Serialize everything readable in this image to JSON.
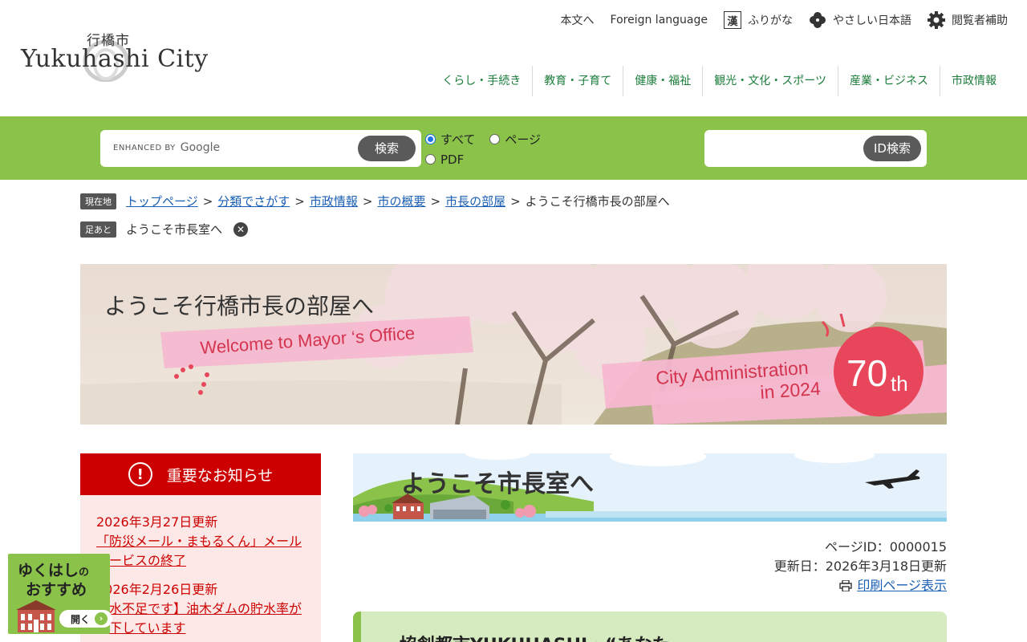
{
  "header": {
    "logo_jp": "行橋市",
    "logo_en": "Yukuhashi City",
    "util": [
      {
        "label": "本文へ",
        "icon": ""
      },
      {
        "label": "Foreign language",
        "icon": ""
      },
      {
        "label": "ふりがな",
        "icon": "kanji-icon",
        "glyph": "漢"
      },
      {
        "label": "やさしい日本語",
        "icon": "clover-icon"
      },
      {
        "label": "閲覧者補助",
        "icon": "gear-icon"
      }
    ],
    "gnav": [
      "くらし・手続き",
      "教育・子育て",
      "健康・福祉",
      "観光・文化・スポーツ",
      "産業・ビジネス",
      "市政情報"
    ]
  },
  "search": {
    "enhanced": "ENHANCED BY",
    "google": "Google",
    "button": "検索",
    "scope": [
      {
        "label": "すべて",
        "checked": true
      },
      {
        "label": "ページ",
        "checked": false
      },
      {
        "label": "PDF",
        "checked": false
      }
    ],
    "id_button": "ID検索"
  },
  "breadcrumb": {
    "tag": "現在地",
    "links": [
      "トップページ",
      "分類でさがす",
      "市政情報",
      "市の概要",
      "市長の部屋"
    ],
    "current": "ようこそ行橋市長の部屋へ"
  },
  "footprint": {
    "tag": "足あと",
    "item": "ようこそ市長室へ"
  },
  "hero": {
    "title": "ようこそ行橋市長の部屋へ",
    "subtitle": "Welcome to Mayor ‘s Office",
    "admin_line1": "City Administration",
    "admin_line2": "in 2024",
    "anniv_num": "70",
    "anniv_suffix": "th"
  },
  "notice": {
    "title": "重要なお知らせ",
    "items": [
      {
        "date": "2026年3月27日更新",
        "text": "「防災メール・まもるくん」メールサービスの終了"
      },
      {
        "date": "2026年2月26日更新",
        "text": "【水不足です】油木ダムの貯水率が低下しています"
      }
    ]
  },
  "recommend": {
    "line1": "ゆくはし",
    "line1_small": "の",
    "line2": "おすすめ",
    "open": "開く"
  },
  "content": {
    "banner_title": "ようこそ市長室へ",
    "page_id": "ページID：0000015",
    "updated": "更新日：2026年3月18日更新",
    "print": "印刷ページ表示",
    "section_title": "協創都市YUKUHASHI・“あなた"
  },
  "colors": {
    "green": "#8bc34a",
    "nav_green": "#1a7c3a",
    "notice_red": "#cc0000",
    "link_blue": "#1a5fb4"
  }
}
